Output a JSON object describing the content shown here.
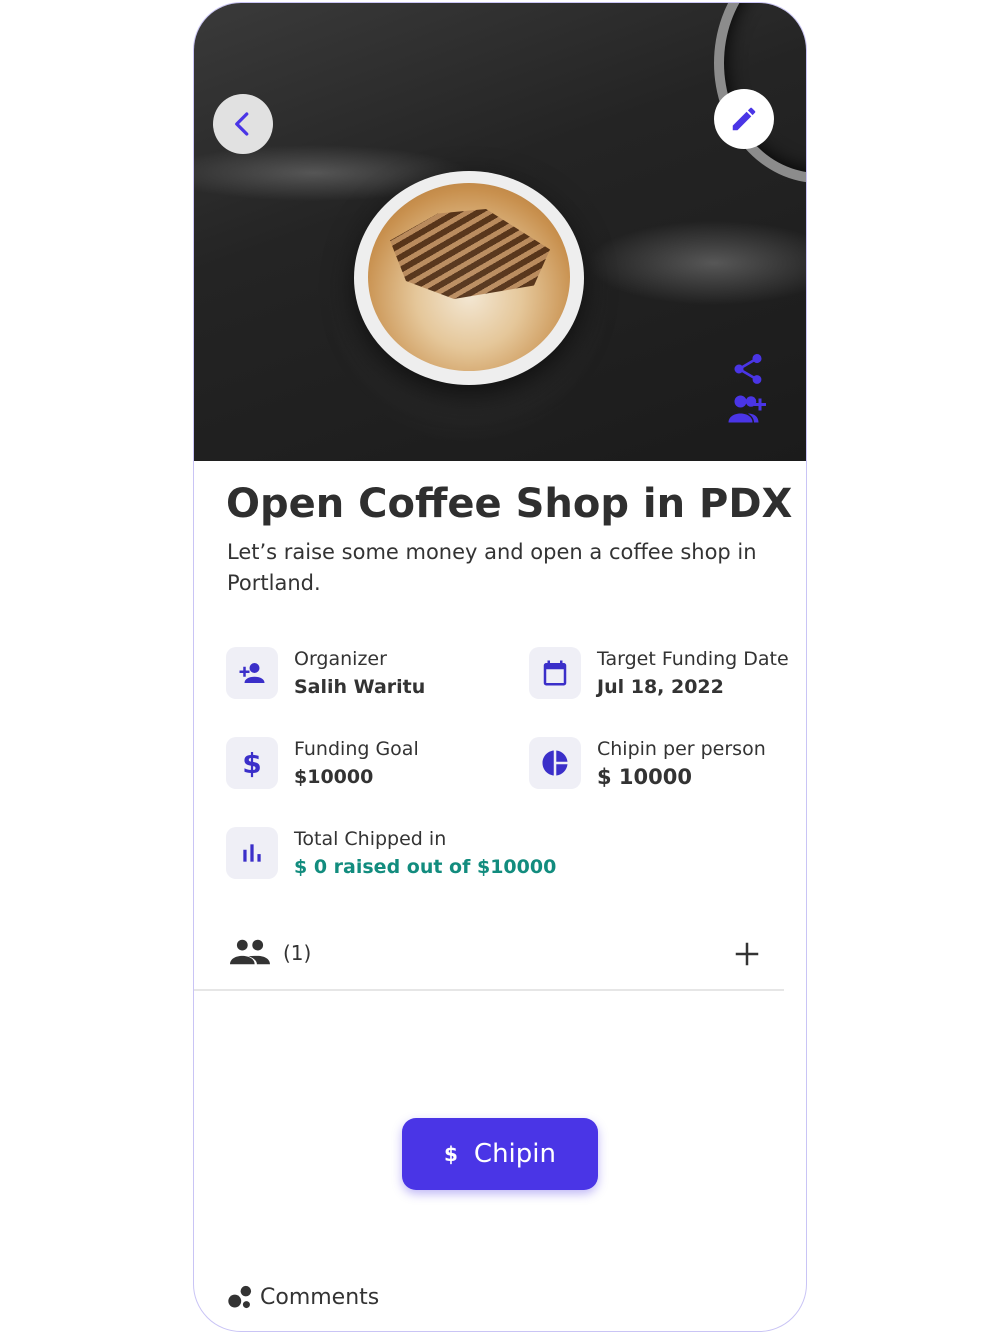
{
  "hero": {
    "back_icon": "chevron-left-icon",
    "edit_icon": "pencil-icon",
    "share_icon": "share-icon",
    "invite_icon": "group-add-icon",
    "accent_color": "#4a35e6"
  },
  "campaign": {
    "title": "Open Coffee Shop in PDX",
    "description": "Let’s raise some money and open a coffee shop in Portland."
  },
  "details": {
    "organizer": {
      "label": "Organizer",
      "value": "Salih Waritu",
      "icon": "person-add-icon"
    },
    "target_date": {
      "label": "Target Funding Date",
      "value": "Jul 18, 2022",
      "icon": "calendar-icon"
    },
    "funding_goal": {
      "label": "Funding Goal",
      "value": "$10000",
      "icon": "dollar-icon"
    },
    "per_person": {
      "label": "Chipin per person",
      "value": "$ 10000",
      "icon": "pie-chart-icon"
    },
    "total": {
      "label": "Total Chipped in",
      "value": "$ 0 raised out of $10000",
      "icon": "bar-chart-icon",
      "value_color": "#128c7e"
    }
  },
  "members": {
    "count": "(1)",
    "icon": "people-icon",
    "add_icon": "plus-icon"
  },
  "chipin_button": {
    "symbol": "$",
    "label": "Chipin"
  },
  "comments": {
    "label": "Comments",
    "icon": "bubbles-icon"
  }
}
